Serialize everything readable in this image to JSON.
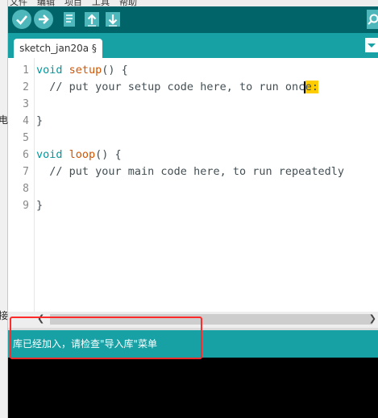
{
  "window": {
    "menubar_items": [
      "文件",
      "编辑",
      "项目",
      "工具",
      "帮助"
    ],
    "side_text_1": "电",
    "side_text_2": "接"
  },
  "toolbar": {
    "buttons": [
      {
        "name": "verify",
        "icon": "check-icon"
      },
      {
        "name": "upload",
        "icon": "arrow-right-icon"
      },
      {
        "name": "new",
        "icon": "new-file-icon"
      },
      {
        "name": "open",
        "icon": "arrow-up-icon"
      },
      {
        "name": "save",
        "icon": "arrow-down-icon"
      }
    ],
    "serial_monitor_icon": "magnifier-icon",
    "accent": "#4db7bb",
    "background": "#006468"
  },
  "tabs": [
    {
      "label": "sketch_jan20a §"
    }
  ],
  "editor": {
    "line_numbers": [
      "1",
      "2",
      "3",
      "4",
      "5",
      "6",
      "7",
      "8",
      "9"
    ],
    "lines": {
      "l1_kw": "void",
      "l1_fn": "setup",
      "l1_rest": "() {",
      "l2_comment_a": "  // put your setup code here, to run onc",
      "l2_comment_b": "e:",
      "l4": "}",
      "l6_kw": "void",
      "l6_fn": "loop",
      "l6_rest": "() {",
      "l7_comment": "  // put your main code here, to run repeatedly",
      "l9": "}"
    },
    "highlight_color": "#ffcc00"
  },
  "status_bar": {
    "message": "库已经加入，请检查\"导入库\"菜单",
    "background": "#17a1a5"
  },
  "annotation": {
    "color": "#ff2a2a"
  }
}
